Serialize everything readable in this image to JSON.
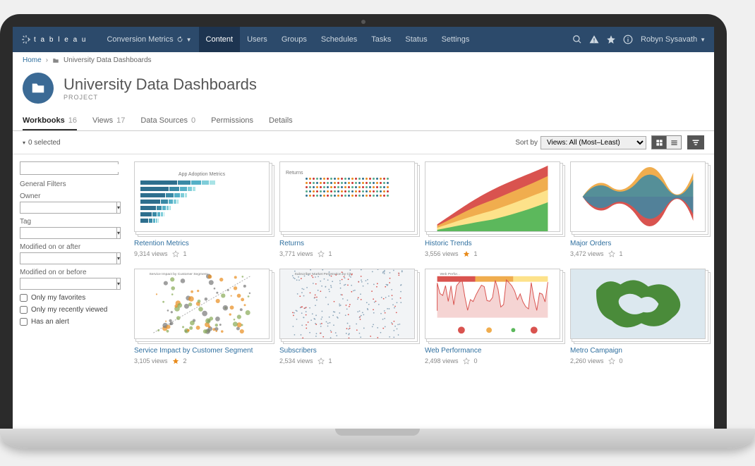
{
  "brand": "t a b l e a u",
  "nav": {
    "site": "Conversion Metrics",
    "items": [
      "Content",
      "Users",
      "Groups",
      "Schedules",
      "Tasks",
      "Status",
      "Settings"
    ],
    "active": "Content",
    "user": "Robyn Sysavath"
  },
  "breadcrumb": {
    "home": "Home",
    "current": "University Data Dashboards"
  },
  "header": {
    "title": "University Data Dashboards",
    "subtitle": "PROJECT"
  },
  "tabs": [
    {
      "label": "Workbooks",
      "count": "16",
      "active": true
    },
    {
      "label": "Views",
      "count": "17"
    },
    {
      "label": "Data Sources",
      "count": "0"
    },
    {
      "label": "Permissions"
    },
    {
      "label": "Details"
    }
  ],
  "toolbar": {
    "selected": "0 selected",
    "sort_label": "Sort by",
    "sort_value": "Views: All (Most–Least)"
  },
  "filters": {
    "search_placeholder": "",
    "title": "General Filters",
    "owner": "Owner",
    "tag": "Tag",
    "mod_after": "Modified on or after",
    "mod_before": "Modified on or before",
    "only_fav": "Only my favorites",
    "only_recent": "Only my recently viewed",
    "has_alert": "Has an alert"
  },
  "cards": [
    {
      "title": "Retention Metrics",
      "views": "9,314 views",
      "fav": false,
      "favcount": "1",
      "thumb": "bars",
      "ttl": "App Adoption Metrics"
    },
    {
      "title": "Returns",
      "views": "3,771 views",
      "fav": false,
      "favcount": "1",
      "thumb": "dots",
      "ttl": "Returns"
    },
    {
      "title": "Historic Trends",
      "views": "3,556 views",
      "fav": true,
      "favcount": "1",
      "thumb": "area"
    },
    {
      "title": "Major Orders",
      "views": "3,472 views",
      "fav": false,
      "favcount": "1",
      "thumb": "mirror"
    },
    {
      "title": "Service Impact by Customer Segment",
      "views": "3,105 views",
      "fav": true,
      "favcount": "2",
      "thumb": "scatter",
      "ttl": "Service Impact by Customer Segment"
    },
    {
      "title": "Subscribers",
      "views": "2,534 views",
      "fav": false,
      "favcount": "1",
      "thumb": "map1",
      "ttl": "Subscriber Market Penetration by City"
    },
    {
      "title": "Web Performance",
      "views": "2,498 views",
      "fav": false,
      "favcount": "0",
      "thumb": "spark",
      "ttl": "Web Perfor..."
    },
    {
      "title": "Metro Campaign",
      "views": "2,260 views",
      "fav": false,
      "favcount": "0",
      "thumb": "map2"
    }
  ]
}
